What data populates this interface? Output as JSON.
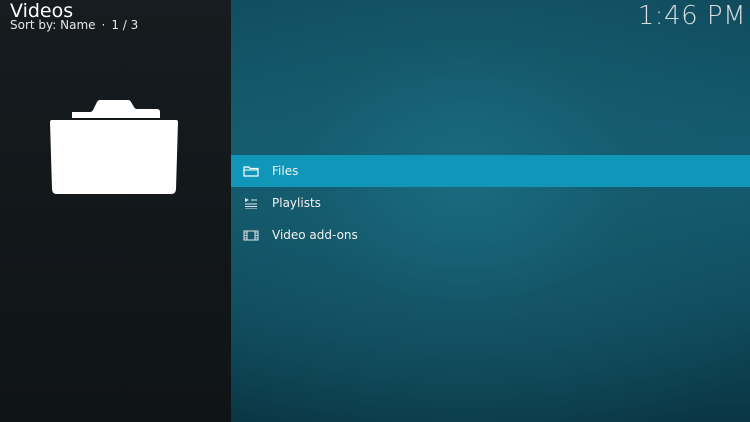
{
  "header": {
    "title": "Videos",
    "sort_label": "Sort by: Name",
    "separator": "·",
    "page_position": "1 / 3"
  },
  "clock": {
    "time": "1:46 PM"
  },
  "preview": {
    "icon": "folder-icon"
  },
  "menu": {
    "items": [
      {
        "label": "Files",
        "icon": "folder-icon",
        "selected": true
      },
      {
        "label": "Playlists",
        "icon": "playlist-icon",
        "selected": false
      },
      {
        "label": "Video add-ons",
        "icon": "film-addon-icon",
        "selected": false
      }
    ]
  },
  "colors": {
    "selection": "#0f96b8",
    "left_panel": "#141a1d",
    "right_panel": "#145d72"
  }
}
